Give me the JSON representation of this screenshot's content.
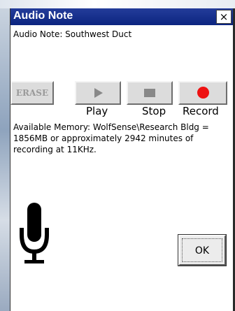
{
  "window": {
    "title": "Audio Note",
    "close_label": "×"
  },
  "note": {
    "title": "Audio Note: Southwest Duct"
  },
  "controls": {
    "erase_label": "ERASE",
    "play_label": "Play",
    "stop_label": "Stop",
    "record_label": "Record"
  },
  "memory": {
    "text": "Available Memory: WolfSense\\Research Bldg = 1856MB or approximately 2942 minutes of recording at 11KHz."
  },
  "actions": {
    "ok_label": "OK"
  },
  "colors": {
    "titlebar": "#0c2580",
    "record": "#ee1111"
  },
  "icons": {
    "play": "play-icon",
    "stop": "stop-icon",
    "record": "record-icon",
    "microphone": "microphone-icon"
  }
}
